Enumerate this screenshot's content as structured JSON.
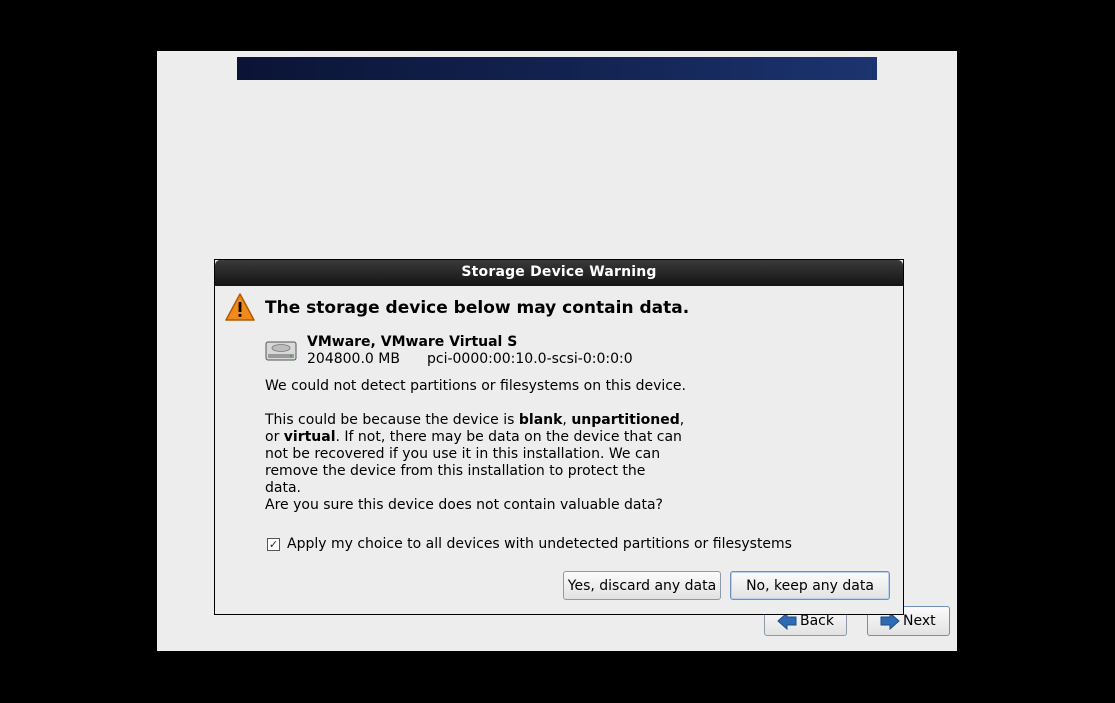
{
  "installer": {
    "back_label": "Back",
    "next_label": "Next"
  },
  "dialog": {
    "title": "Storage Device Warning",
    "headline": "The storage device below may contain data.",
    "device": {
      "name": "VMware, VMware Virtual S",
      "size": "204800.0 MB",
      "path": "pci-0000:00:10.0-scsi-0:0:0:0"
    },
    "message_1": "We could not detect partitions or filesystems on this device.",
    "message_2": {
      "part_1": "This could be because the device is ",
      "blank": "blank",
      "sep_1": ", ",
      "unpartitioned": "unpartitioned",
      "sep_2": ", or ",
      "virtual": "virtual",
      "part_2": ". If not, there may be data on the device that can not be recovered if you use it in this installation. We can remove the device from this installation to protect the data."
    },
    "question": "Are you sure this device does not contain valuable data?",
    "apply_all": {
      "label": "Apply my choice to all devices with undetected partitions or filesystems",
      "checked_glyph": "✓"
    },
    "yes_label": "Yes, discard any data",
    "no_label": "No, keep any data"
  },
  "icons": {
    "warning": "warning-triangle-icon",
    "disk": "hard-disk-icon",
    "back": "back-arrow-icon",
    "next": "next-arrow-icon"
  },
  "colors": {
    "banner": "#132352",
    "titlebar": "#1e1e1e",
    "warning": "#f08a1c",
    "nav_arrow": "#2f6bb5"
  }
}
